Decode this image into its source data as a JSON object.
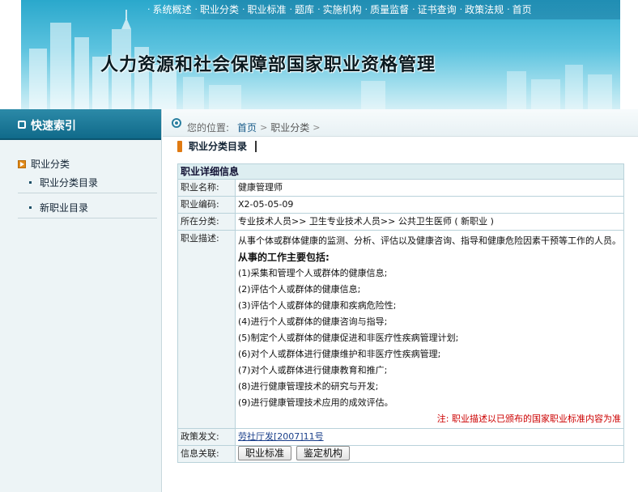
{
  "nav": {
    "items": [
      "系统概述",
      "职业分类",
      "职业标准",
      "题库",
      "实施机构",
      "质量监督",
      "证书查询",
      "政策法规",
      "首页"
    ],
    "separator": "·"
  },
  "site": {
    "title": "人力资源和社会保障部国家职业资格管理"
  },
  "sidebar": {
    "header": "快速索引",
    "category": "职业分类",
    "items": [
      "职业分类目录",
      "新职业目录"
    ]
  },
  "breadcrumb": {
    "prefix": "您的位置:",
    "home": "首页",
    "chevron": ">",
    "category": "职业分类"
  },
  "section_title": "职业分类目录",
  "detail": {
    "header": "职业详细信息",
    "name_label": "职业名称:",
    "name": "健康管理师",
    "code_label": "职业编码:",
    "code": "X2-05-05-09",
    "category_label": "所在分类:",
    "category_path": "专业技术人员>> 卫生专业技术人员>> 公共卫生医师 ( 新职业 )",
    "description_label": "职业描述:",
    "description_intro": "从事个体或群体健康的监测、分析、评估以及健康咨询、指导和健康危险因素干预等工作的人员。",
    "duties_title": "从事的工作主要包括:",
    "duties": [
      "(1)采集和管理个人或群体的健康信息;",
      "(2)评估个人或群体的健康信息;",
      "(3)评估个人或群体的健康和疾病危险性;",
      "(4)进行个人或群体的健康咨询与指导;",
      "(5)制定个人或群体的健康促进和非医疗性疾病管理计划;",
      "(6)对个人或群体进行健康维护和非医疗性疾病管理;",
      "(7)对个人或群体进行健康教育和推广;",
      "(8)进行健康管理技术的研究与开发;",
      "(9)进行健康管理技术应用的成效评估。"
    ],
    "note": "注: 职业描述以已颁布的国家职业标准内容为准",
    "policy_label": "政策发文:",
    "policy_doc": "劳社厅发[2007]11号",
    "related_label": "信息关联:",
    "related_buttons": [
      "职业标准",
      "鉴定机构"
    ]
  },
  "colors": {
    "banner_sky": "#5cc3df",
    "sidebar_header": "#106a8a",
    "table_border": "#b9d2da",
    "note_red": "#cc0000",
    "accent_orange": "#e07a12"
  }
}
